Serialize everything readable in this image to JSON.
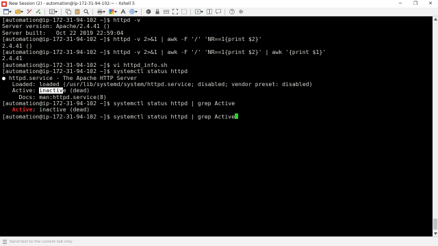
{
  "window": {
    "title": "New Session (2) - automation@ip-172-31-94-102:~ - Xshell 5",
    "minimize_glyph": "─",
    "maximize_glyph": "❐",
    "close_glyph": "✕"
  },
  "toolbar": {
    "icons": [
      "new-session-icon",
      "folder-icon",
      "disconnect-icon",
      "properties-icon",
      "copy-icon",
      "paste-icon",
      "find-icon",
      "print-icon",
      "transfer-icon",
      "color-scheme-icon",
      "font-icon",
      "globe-icon",
      "lock-icon",
      "script-icon",
      "keyboard-icon",
      "fullscreen-icon",
      "transparent-icon",
      "new-tab-icon",
      "tile-icon",
      "comment-icon",
      "help-icon",
      "settings-icon"
    ]
  },
  "terminal": {
    "lines": [
      [
        {
          "t": "[automation@ip-172-31-94-102 ~]$ httpd -v",
          "s": ""
        }
      ],
      [
        {
          "t": "Server version: Apache/2.4.41 ()",
          "s": ""
        }
      ],
      [
        {
          "t": "Server built:   Oct 22 2019 22:59:04",
          "s": ""
        }
      ],
      [
        {
          "t": "[automation@ip-172-31-94-102 ~]$ httpd -v 2>&1 | awk -F '/' 'NR==1{print $2}'",
          "s": ""
        }
      ],
      [
        {
          "t": "2.4.41 ()",
          "s": ""
        }
      ],
      [
        {
          "t": "[automation@ip-172-31-94-102 ~]$ httpd -v 2>&1 | awk -F '/' 'NR==1{print $2}' | awk '{print $1}'",
          "s": ""
        }
      ],
      [
        {
          "t": "2.4.41",
          "s": ""
        }
      ],
      [
        {
          "t": "[automation@ip-172-31-94-102 ~]$ vi httpd_info.sh",
          "s": ""
        }
      ],
      [
        {
          "t": "[automation@ip-172-31-94-102 ~]$ systemctl status httpd",
          "s": ""
        }
      ],
      [
        {
          "t": "● ",
          "s": "white"
        },
        {
          "t": "httpd.service - The Apache HTTP Server",
          "s": ""
        }
      ],
      [
        {
          "t": "   Loaded: loaded (/usr/lib/systemd/system/httpd.service; disabled; vendor preset: disabled)",
          "s": ""
        }
      ],
      [
        {
          "t": "   Active: ",
          "s": ""
        },
        {
          "t": "inactiv",
          "s": "selected"
        },
        {
          "t": "e (dead)",
          "s": ""
        }
      ],
      [
        {
          "t": "     Docs: man:httpd.service(8)",
          "s": ""
        }
      ],
      [
        {
          "t": "[automation@ip-172-31-94-102 ~]$ systemctl status httpd | grep Active",
          "s": ""
        }
      ],
      [
        {
          "t": "   ",
          "s": ""
        },
        {
          "t": "Active",
          "s": "bold-red"
        },
        {
          "t": ": inactive (dead)",
          "s": ""
        }
      ],
      [
        {
          "t": "[automation@ip-172-31-94-102 ~]$ systemctl status httpd | grep Active",
          "s": ""
        },
        {
          "t": "",
          "s": "cursor"
        }
      ]
    ]
  },
  "status": {
    "send_placeholder": "Send text to the current tab only"
  }
}
